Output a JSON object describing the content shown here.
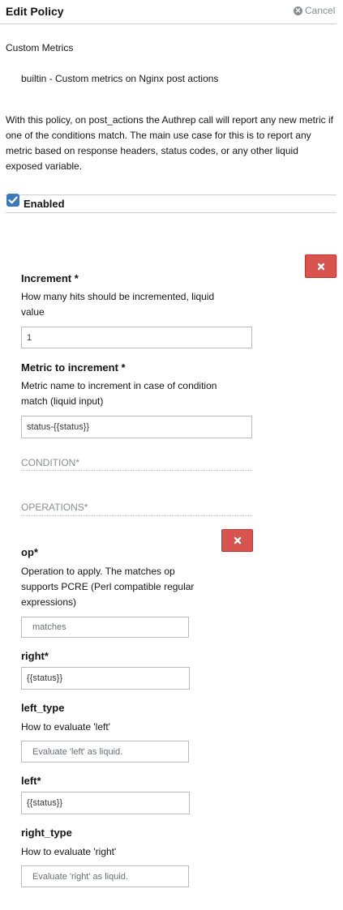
{
  "header": {
    "title": "Edit Policy",
    "cancel_label": "Cancel"
  },
  "policy": {
    "name": "Custom Metrics",
    "summary": "builtin - Custom metrics on Nginx post actions",
    "description": "With this policy, on post_actions the Authrep call will report any new metric if one of the conditions match. The main use case for this is to report any metric based on response headers, status codes, or any other liquid exposed variable."
  },
  "enabled": {
    "label": "Enabled",
    "checked": true
  },
  "rule": {
    "increment": {
      "label": "Increment *",
      "help": "How many hits should be incremented, liquid value",
      "value": "1"
    },
    "metric": {
      "label": "Metric to increment *",
      "help": "Metric name to increment in case of condition match (liquid input)",
      "value": "status-{{status}}"
    },
    "condition_title": "CONDITION*",
    "operations_title": "OPERATIONS*",
    "operation": {
      "op": {
        "label": "op*",
        "help": "Operation to apply. The matches op supports PCRE (Perl compatible regular expressions)",
        "value": "matches"
      },
      "right": {
        "label": "right*",
        "value": "{{status}}"
      },
      "left_type": {
        "label": "left_type",
        "help": "How to evaluate 'left'",
        "placeholder": "Evaluate 'left' as liquid."
      },
      "left": {
        "label": "left*",
        "value": "{{status}}"
      },
      "right_type": {
        "label": "right_type",
        "help": "How to evaluate 'right'",
        "placeholder": "Evaluate 'right' as liquid."
      }
    }
  },
  "colors": {
    "danger": "#d9534f",
    "checkbox": "#3978c0",
    "muted": "#8b8d8f"
  }
}
